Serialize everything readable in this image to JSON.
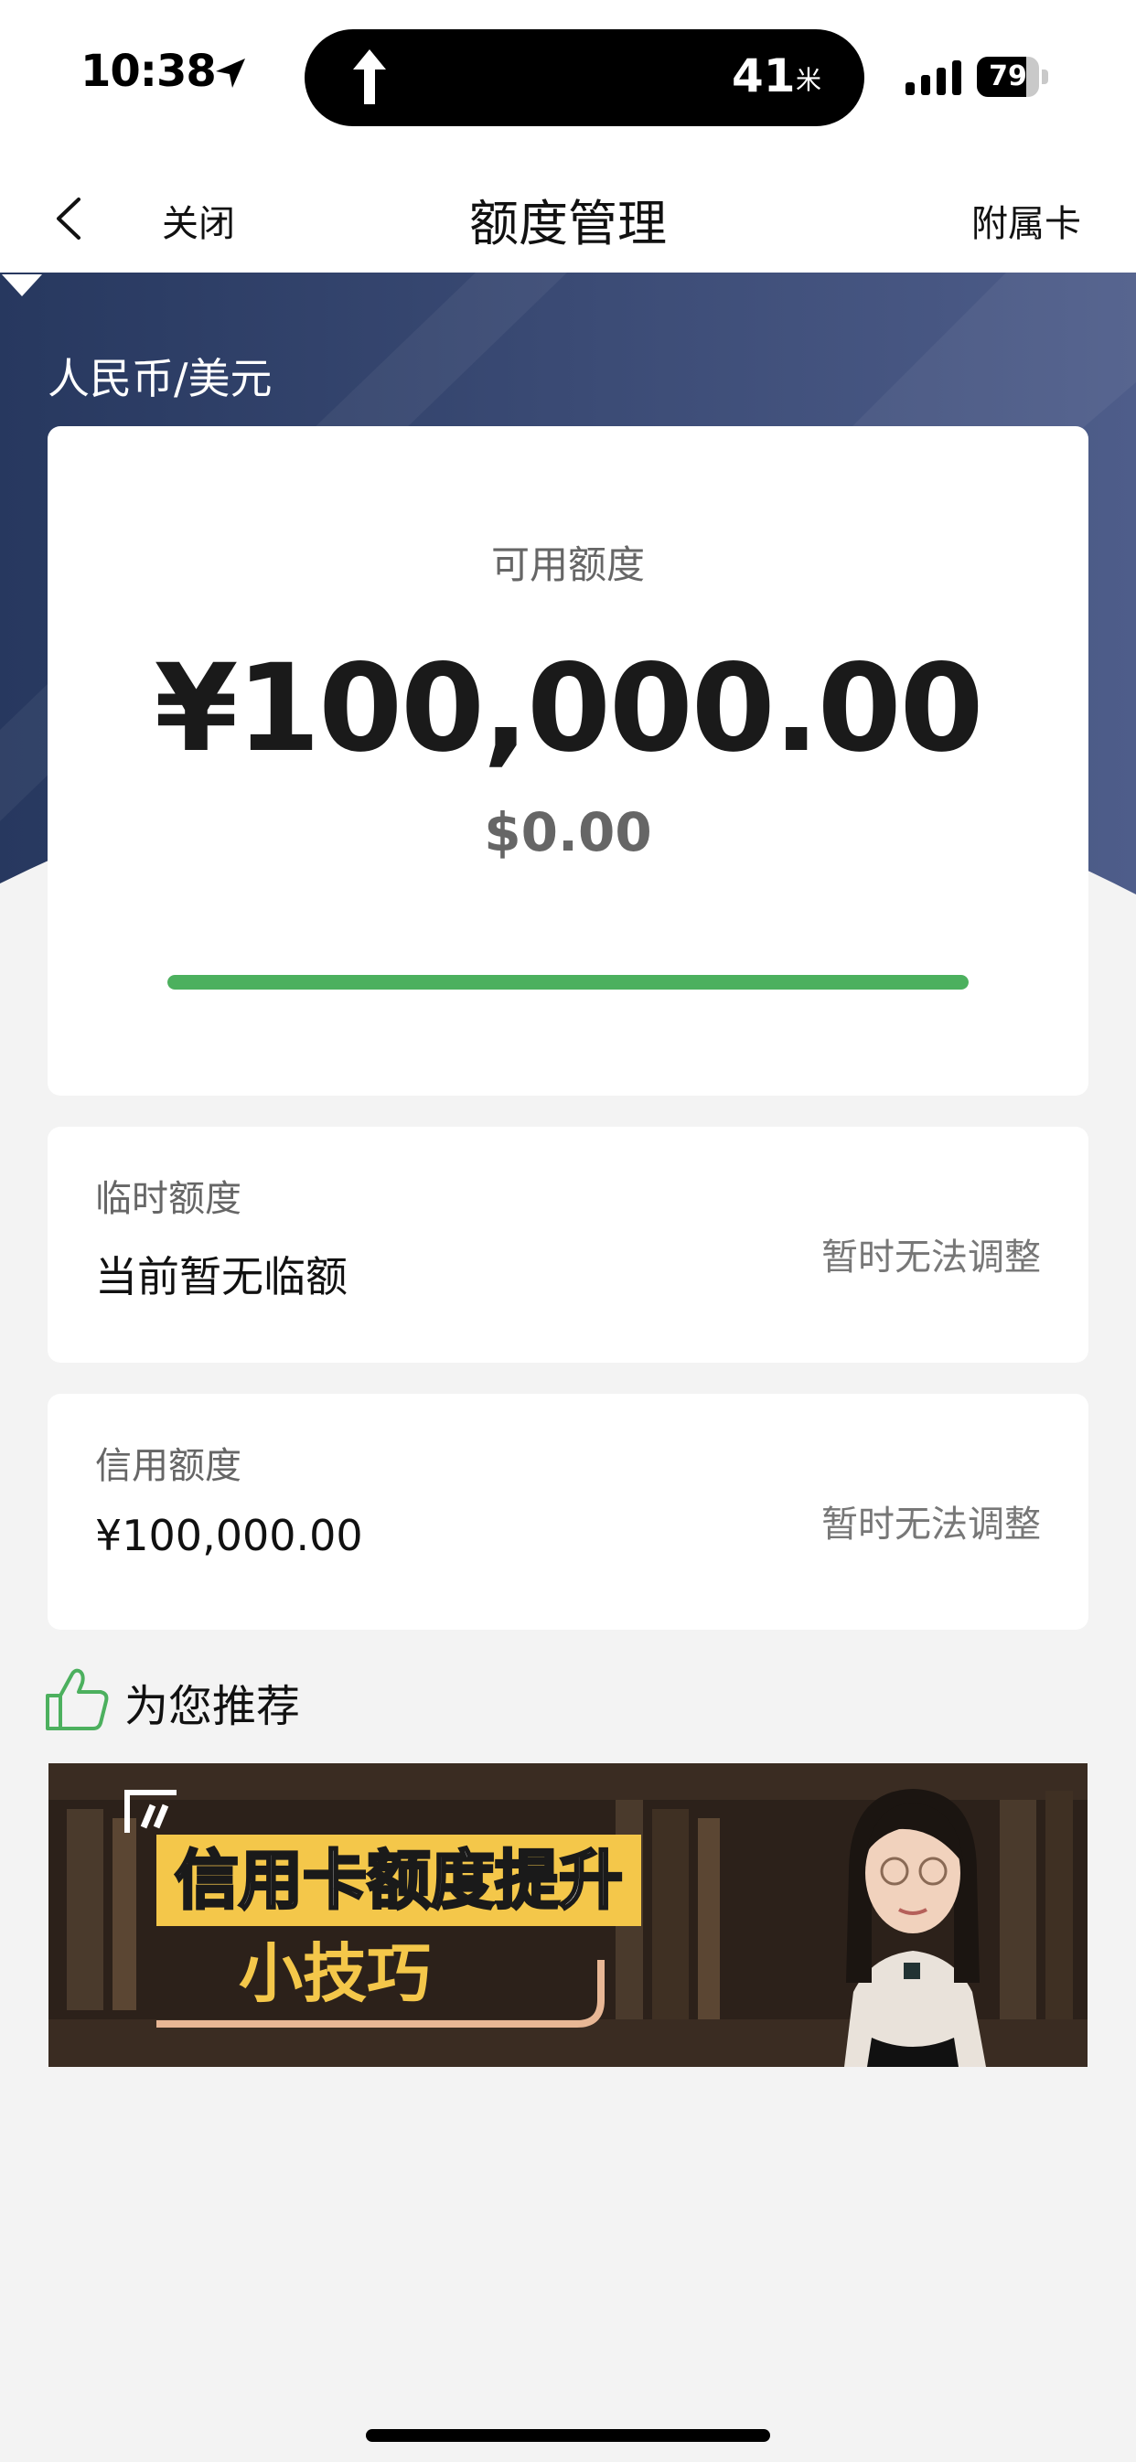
{
  "status_bar": {
    "time": "10:38",
    "island_temperature": "41",
    "island_unit": "米",
    "battery_level": "79",
    "battery_fraction": 0.79
  },
  "nav": {
    "close_label": "关闭",
    "title": "额度管理",
    "sub_card_label": "附属卡"
  },
  "currency": {
    "selected": "人民币/美元"
  },
  "available": {
    "label": "可用额度",
    "cny_amount": "¥100,000.00",
    "usd_amount": "$0.00",
    "usage_fraction": 1.0
  },
  "temporary_limit": {
    "title": "临时额度",
    "value": "当前暂无临额",
    "action": "暂时无法调整"
  },
  "credit_limit": {
    "title": "信用额度",
    "value": "¥100,000.00",
    "action": "暂时无法调整"
  },
  "recommend": {
    "title": "为您推荐",
    "banner_line1": "信用卡额度提升",
    "banner_line2": "小技巧"
  },
  "colors": {
    "hero_gradient_start": "#27385f",
    "hero_gradient_end": "#4e5d8a",
    "progress": "#4cb05e",
    "banner_highlight": "#f4c74a"
  }
}
